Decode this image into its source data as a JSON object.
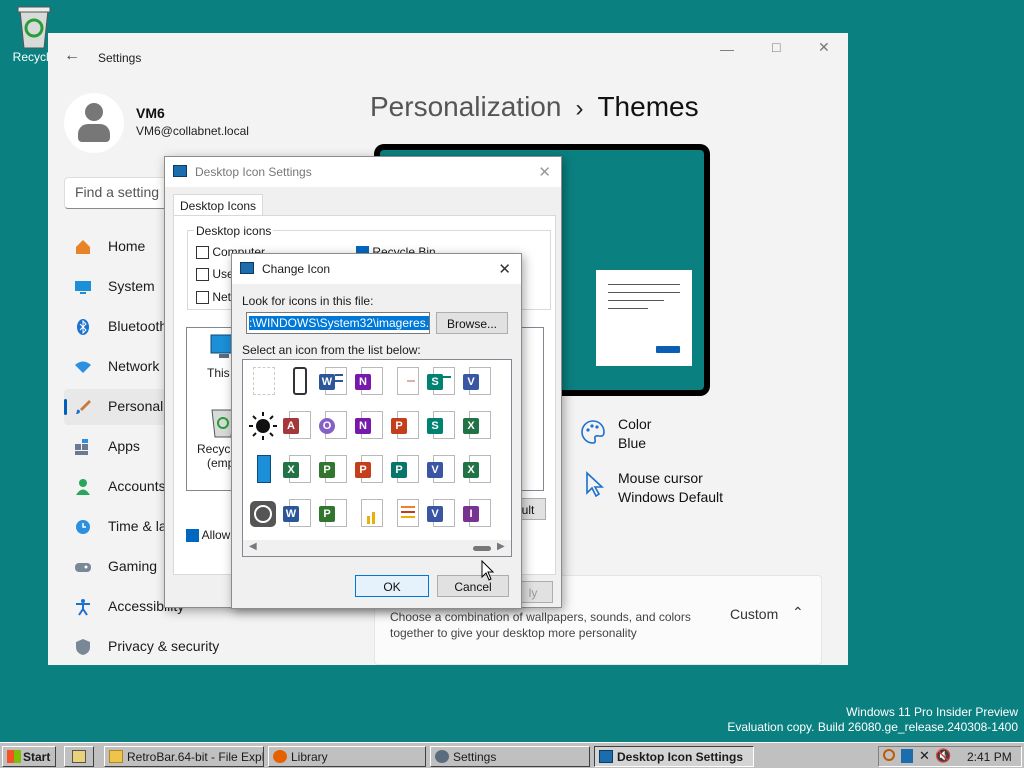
{
  "desktop": {
    "recycle_label": "Recycle",
    "watermark_line1": "Windows 11 Pro Insider Preview",
    "watermark_line2": "Evaluation copy. Build 26080.ge_release.240308-1400"
  },
  "settings": {
    "title": "Settings",
    "user_name": "VM6",
    "user_email": "VM6@collabnet.local",
    "search_placeholder": "Find a setting",
    "nav": [
      {
        "label": "Home",
        "icon": "home-icon"
      },
      {
        "label": "System",
        "icon": "monitor-icon"
      },
      {
        "label": "Bluetooth",
        "icon": "bluetooth-icon"
      },
      {
        "label": "Network",
        "icon": "wifi-icon"
      },
      {
        "label": "Personali",
        "icon": "brush-icon"
      },
      {
        "label": "Apps",
        "icon": "apps-icon"
      },
      {
        "label": "Accounts",
        "icon": "person-icon"
      },
      {
        "label": "Time & la",
        "icon": "clock-globe-icon"
      },
      {
        "label": "Gaming",
        "icon": "gamepad-icon"
      },
      {
        "label": "Accessibility",
        "icon": "accessibility-icon"
      },
      {
        "label": "Privacy & security",
        "icon": "shield-icon"
      }
    ],
    "breadcrumb_parent": "Personalization",
    "breadcrumb_sep": "›",
    "breadcrumb_current": "Themes",
    "color_title": "Color",
    "color_value": "Blue",
    "cursor_title": "Mouse cursor",
    "cursor_value": "Windows Default",
    "theme_desc": "Choose a combination of wallpapers, sounds, and colors together to give your desktop more personality",
    "theme_value": "Custom",
    "accent": "#005fb8"
  },
  "desktop_icon_settings": {
    "title": "Desktop Icon Settings",
    "tab": "Desktop Icons",
    "group": "Desktop icons",
    "checks": [
      {
        "label": "Computer",
        "checked": false
      },
      {
        "label": "User",
        "checked": false
      },
      {
        "label": "Netw",
        "checked": false
      },
      {
        "label": "Recycle Bin",
        "checked": true
      }
    ],
    "preview_pc": "This P",
    "preview_bin_1": "Recycle",
    "preview_bin_2": "(empt",
    "default_btn": "ult",
    "allow": "Allow t",
    "apply": "ly"
  },
  "change_icon": {
    "title": "Change Icon",
    "look_label": "Look for icons in this file:",
    "path": ":\\WINDOWS\\System32\\imageres.dll",
    "browse": "Browse...",
    "select_label": "Select an icon from the list below:",
    "ok": "OK",
    "cancel": "Cancel"
  },
  "taskbar": {
    "start": "Start",
    "items": [
      {
        "label": "RetroBar.64-bit - File Explo...",
        "icon": "folder-icon"
      },
      {
        "label": "Library",
        "icon": "firefox-icon"
      },
      {
        "label": "Settings",
        "icon": "gear-icon"
      },
      {
        "label": "Desktop Icon Settings",
        "icon": "app-icon"
      }
    ],
    "clock": "2:41 PM"
  }
}
